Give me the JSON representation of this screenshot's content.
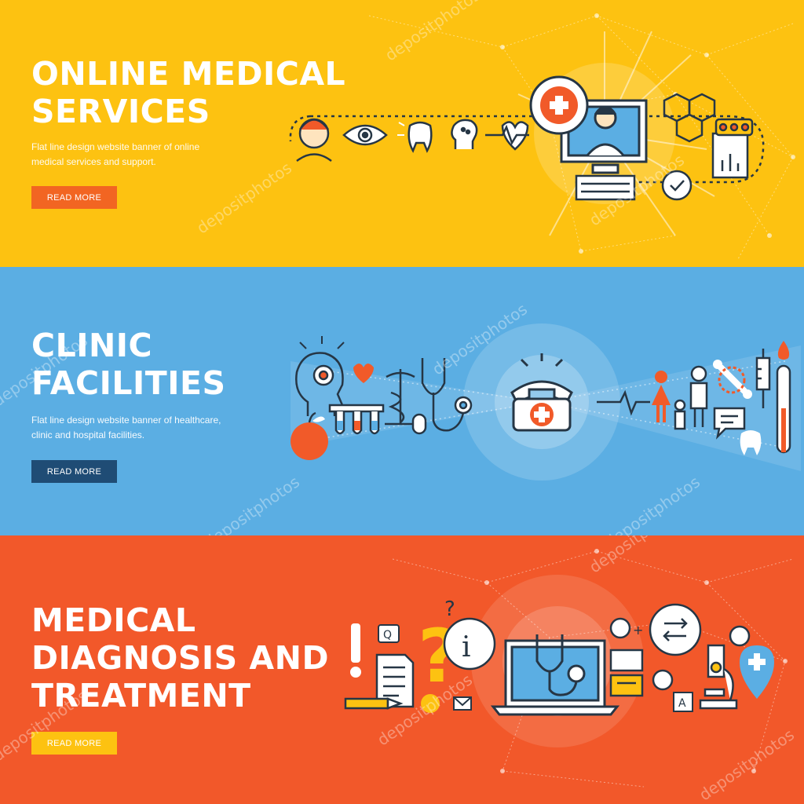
{
  "banners": [
    {
      "title_lines": [
        "ONLINE MEDICAL",
        "SERVICES"
      ],
      "description_lines": [
        "Flat line design website banner of online",
        "medical services and support."
      ],
      "button_label": "READ MORE"
    },
    {
      "title_lines": [
        "CLINIC",
        "FACILITIES"
      ],
      "description_lines": [
        "Flat line design website banner of healthcare,",
        "clinic and hospital facilities."
      ],
      "button_label": "READ MORE"
    },
    {
      "title_lines": [
        "MEDICAL",
        "DIAGNOSIS AND",
        "TREATMENT"
      ],
      "button_label": "READ MORE"
    }
  ],
  "watermark": "depositphotos",
  "colors": {
    "yellow": "#FDC211",
    "blue": "#5BAEE3",
    "orange": "#F2582A",
    "button_orange": "#F26522",
    "button_navy": "#1F4C75",
    "button_yellow": "#FDC211",
    "line_dark": "#263645",
    "accent_red": "#F15A29"
  },
  "icons": {
    "banner1": [
      "user-icon",
      "eye-icon",
      "tooth-icon",
      "brain-head-icon",
      "heartbeat-icon",
      "medical-cross-icon",
      "doctor-monitor-icon",
      "keyboard-icon",
      "molecule-icon",
      "pill-box-icon",
      "checkmark-icon"
    ],
    "banner2": [
      "head-brain-icon",
      "heart-icon",
      "test-tubes-icon",
      "caduceus-icon",
      "stethoscope-icon",
      "apple-icon",
      "emergency-phone-icon",
      "pulse-icon",
      "woman-icon",
      "family-icon",
      "bone-icon",
      "syringe-icon",
      "thermometer-icon",
      "speech-bubble-icon",
      "tooth-icon"
    ],
    "banner3": [
      "exclamation-icon",
      "question-mark-icon",
      "document-icon",
      "pencil-icon",
      "info-bubble-icon",
      "laptop-stethoscope-icon",
      "transfer-arrows-icon",
      "user-add-icon",
      "chat-icon",
      "microscope-icon",
      "location-pin-icon"
    ]
  }
}
